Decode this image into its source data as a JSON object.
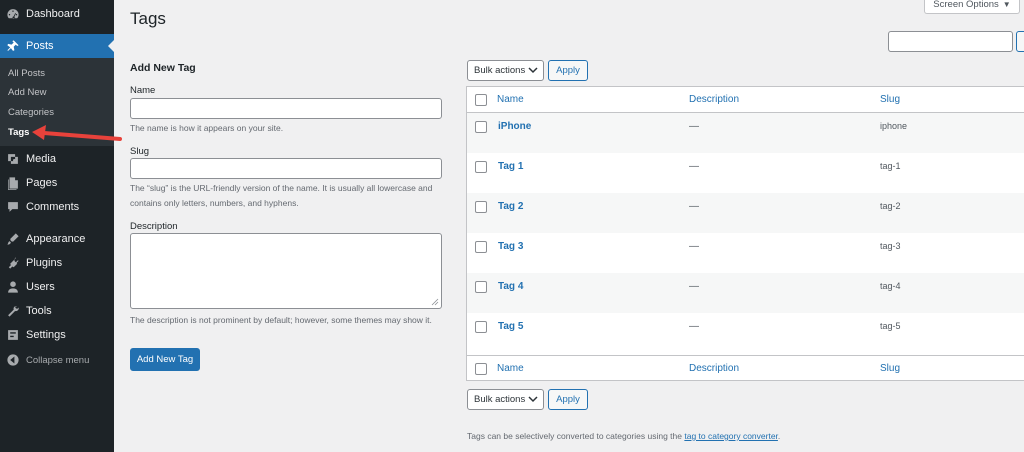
{
  "sidebar": {
    "menu": [
      {
        "label": "Dashboard",
        "icon": "dashboard-icon"
      },
      {
        "label": "Posts",
        "icon": "pin-icon"
      },
      {
        "label": "Media",
        "icon": "media-icon"
      },
      {
        "label": "Pages",
        "icon": "pages-icon"
      },
      {
        "label": "Comments",
        "icon": "comments-icon"
      },
      {
        "label": "Appearance",
        "icon": "appearance-icon"
      },
      {
        "label": "Plugins",
        "icon": "plugins-icon"
      },
      {
        "label": "Users",
        "icon": "users-icon"
      },
      {
        "label": "Tools",
        "icon": "tools-icon"
      },
      {
        "label": "Settings",
        "icon": "settings-icon"
      }
    ],
    "submenu": [
      "All Posts",
      "Add New",
      "Categories",
      "Tags"
    ],
    "collapse_label": "Collapse menu"
  },
  "header": {
    "title": "Tags",
    "screen_options": "Screen Options"
  },
  "form": {
    "title": "Add New Tag",
    "name_label": "Name",
    "name_help": "The name is how it appears on your site.",
    "slug_label": "Slug",
    "slug_help": "The “slug” is the URL-friendly version of the name. It is usually all lowercase and contains only letters, numbers, and hyphens.",
    "description_label": "Description",
    "description_help": "The description is not prominent by default; however, some themes may show it.",
    "submit_label": "Add New Tag"
  },
  "table": {
    "bulk_actions_label": "Bulk actions",
    "apply_label": "Apply",
    "columns": [
      "Name",
      "Description",
      "Slug"
    ],
    "rows": [
      {
        "name": "iPhone",
        "description": "—",
        "slug": "iphone"
      },
      {
        "name": "Tag 1",
        "description": "—",
        "slug": "tag-1"
      },
      {
        "name": "Tag 2",
        "description": "—",
        "slug": "tag-2"
      },
      {
        "name": "Tag 3",
        "description": "—",
        "slug": "tag-3"
      },
      {
        "name": "Tag 4",
        "description": "—",
        "slug": "tag-4"
      },
      {
        "name": "Tag 5",
        "description": "—",
        "slug": "tag-5"
      }
    ]
  },
  "footer": {
    "note_prefix": "Tags can be selectively converted to categories using the ",
    "note_link": "tag to category converter",
    "note_suffix": "."
  },
  "colors": {
    "sidebar_bg": "#1d2327",
    "accent": "#2271b1",
    "annotation_arrow": "#e8423b"
  }
}
